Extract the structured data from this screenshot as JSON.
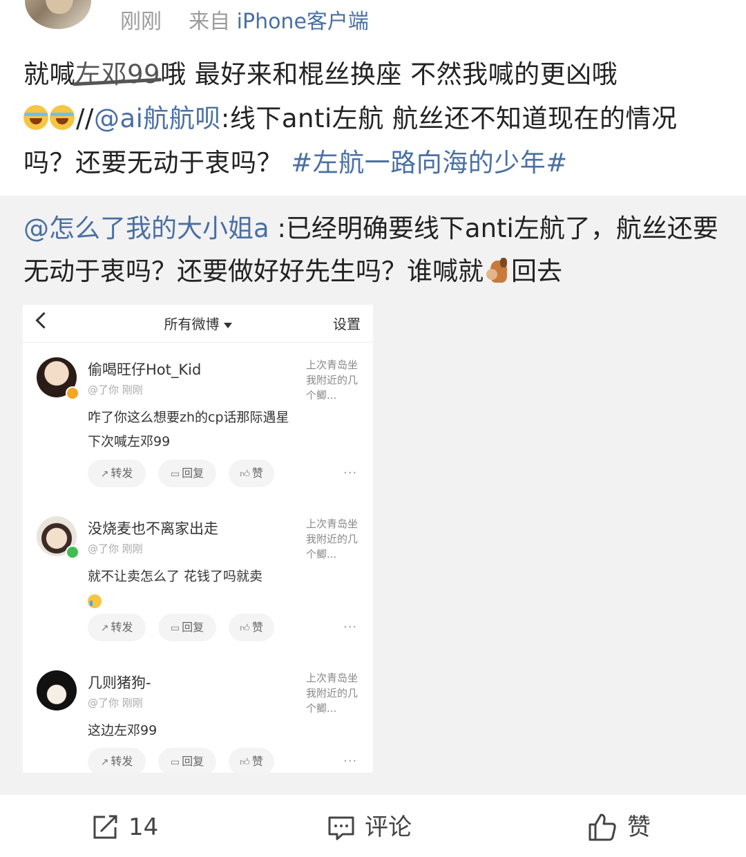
{
  "post": {
    "time": "刚刚",
    "source_prefix": "来自",
    "source": "iPhone客户端",
    "text_start": "就喊",
    "struck_text": "左邓99",
    "text_line1_rest": "哦 最好来和棍丝换座 不然我喊的更凶哦",
    "emoji": [
      "laughing-tears-icon",
      "laughing-tears-icon"
    ],
    "repost_sep": "//",
    "mention": "@ai航航呗",
    "mention_text": ":线下anti左航 航丝还不知道现在的情况吗？还要无动于衷吗？",
    "hashtag": "#左航一路向海的少年#"
  },
  "repost": {
    "mention": "@怎么了我的大小姐a",
    "text": " :已经明确要线下anti左航了，航丝还要无动于衷吗？还要做好好先生吗？谁喊就",
    "emoji": "horse-icon",
    "text_end": "回去"
  },
  "screenshot": {
    "title": "所有微博",
    "settings": "设置",
    "comments": [
      {
        "name": "偷喝旺仔Hot_Kid",
        "sub": "@了你   刚刚",
        "body": "咋了你这么想要zh的cp话那际遇星下次喊左邓99",
        "ref": "上次青岛坐我附近的几个鲫...",
        "badge_color": "#f5a623"
      },
      {
        "name": "没烧麦也不离家出走",
        "sub": "@了你   刚刚",
        "body": "就不让卖怎么了 花钱了吗就卖",
        "ref": "上次青岛坐我附近的几个鲫...",
        "badge_color": "#3fbf4f"
      },
      {
        "name": "几则猪狗-",
        "sub": "@了你   刚刚",
        "body": "这边左邓99",
        "ref": "上次青岛坐我附近的几个鲫..."
      }
    ],
    "actions": {
      "repost": "转发",
      "reply": "回复",
      "like": "赞",
      "more": "···"
    }
  },
  "footer": {
    "repost_count": "14",
    "comment_label": "评论",
    "like_label": "赞"
  }
}
